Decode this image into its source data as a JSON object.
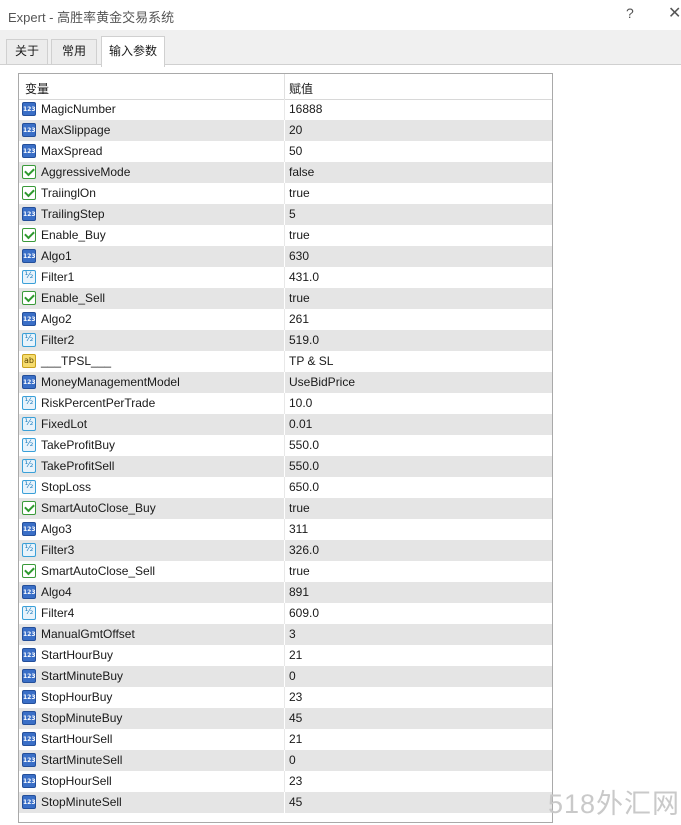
{
  "window": {
    "title": "Expert - 高胜率黄金交易系统",
    "help_label": "?",
    "close_label": "✕"
  },
  "tabs": [
    {
      "label": "关于",
      "active": false
    },
    {
      "label": "常用",
      "active": false
    },
    {
      "label": "输入参数",
      "active": true
    }
  ],
  "grid": {
    "columns": {
      "variable": "变量",
      "value": "赋值"
    },
    "rows": [
      {
        "type": "int",
        "icon": "integer-icon",
        "name": "MagicNumber",
        "value": "16888"
      },
      {
        "type": "int",
        "icon": "integer-icon",
        "name": "MaxSlippage",
        "value": "20"
      },
      {
        "type": "int",
        "icon": "integer-icon",
        "name": "MaxSpread",
        "value": "50"
      },
      {
        "type": "bool",
        "icon": "boolean-icon",
        "name": "AggressiveMode",
        "value": "false"
      },
      {
        "type": "bool",
        "icon": "boolean-icon",
        "name": "TraiinglOn",
        "value": "true"
      },
      {
        "type": "int",
        "icon": "integer-icon",
        "name": "TrailingStep",
        "value": "5"
      },
      {
        "type": "bool",
        "icon": "boolean-icon",
        "name": "Enable_Buy",
        "value": "true"
      },
      {
        "type": "int",
        "icon": "integer-icon",
        "name": "Algo1",
        "value": "630"
      },
      {
        "type": "dbl",
        "icon": "double-icon",
        "name": "Filter1",
        "value": "431.0"
      },
      {
        "type": "bool",
        "icon": "boolean-icon",
        "name": "Enable_Sell",
        "value": "true"
      },
      {
        "type": "int",
        "icon": "integer-icon",
        "name": "Algo2",
        "value": "261"
      },
      {
        "type": "dbl",
        "icon": "double-icon",
        "name": "Filter2",
        "value": "519.0"
      },
      {
        "type": "str",
        "icon": "string-icon",
        "name": "___TPSL___",
        "value": "TP & SL"
      },
      {
        "type": "int",
        "icon": "integer-icon",
        "name": "MoneyManagementModel",
        "value": "UseBidPrice"
      },
      {
        "type": "dbl",
        "icon": "double-icon",
        "name": "RiskPercentPerTrade",
        "value": "10.0"
      },
      {
        "type": "dbl",
        "icon": "double-icon",
        "name": "FixedLot",
        "value": "0.01"
      },
      {
        "type": "dbl",
        "icon": "double-icon",
        "name": "TakeProfitBuy",
        "value": "550.0"
      },
      {
        "type": "dbl",
        "icon": "double-icon",
        "name": "TakeProfitSell",
        "value": "550.0"
      },
      {
        "type": "dbl",
        "icon": "double-icon",
        "name": "StopLoss",
        "value": "650.0"
      },
      {
        "type": "bool",
        "icon": "boolean-icon",
        "name": "SmartAutoClose_Buy",
        "value": "true"
      },
      {
        "type": "int",
        "icon": "integer-icon",
        "name": "Algo3",
        "value": "311"
      },
      {
        "type": "dbl",
        "icon": "double-icon",
        "name": "Filter3",
        "value": "326.0"
      },
      {
        "type": "bool",
        "icon": "boolean-icon",
        "name": "SmartAutoClose_Sell",
        "value": "true"
      },
      {
        "type": "int",
        "icon": "integer-icon",
        "name": "Algo4",
        "value": "891"
      },
      {
        "type": "dbl",
        "icon": "double-icon",
        "name": "Filter4",
        "value": "609.0"
      },
      {
        "type": "int",
        "icon": "integer-icon",
        "name": "ManualGmtOffset",
        "value": "3"
      },
      {
        "type": "int",
        "icon": "integer-icon",
        "name": "StartHourBuy",
        "value": "21"
      },
      {
        "type": "int",
        "icon": "integer-icon",
        "name": "StartMinuteBuy",
        "value": "0"
      },
      {
        "type": "int",
        "icon": "integer-icon",
        "name": "StopHourBuy",
        "value": "23"
      },
      {
        "type": "int",
        "icon": "integer-icon",
        "name": "StopMinuteBuy",
        "value": "45"
      },
      {
        "type": "int",
        "icon": "integer-icon",
        "name": "StartHourSell",
        "value": "21"
      },
      {
        "type": "int",
        "icon": "integer-icon",
        "name": "StartMinuteSell",
        "value": "0"
      },
      {
        "type": "int",
        "icon": "integer-icon",
        "name": "StopHourSell",
        "value": "23"
      },
      {
        "type": "int",
        "icon": "integer-icon",
        "name": "StopMinuteSell",
        "value": "45"
      }
    ]
  },
  "watermark": "518外汇网"
}
